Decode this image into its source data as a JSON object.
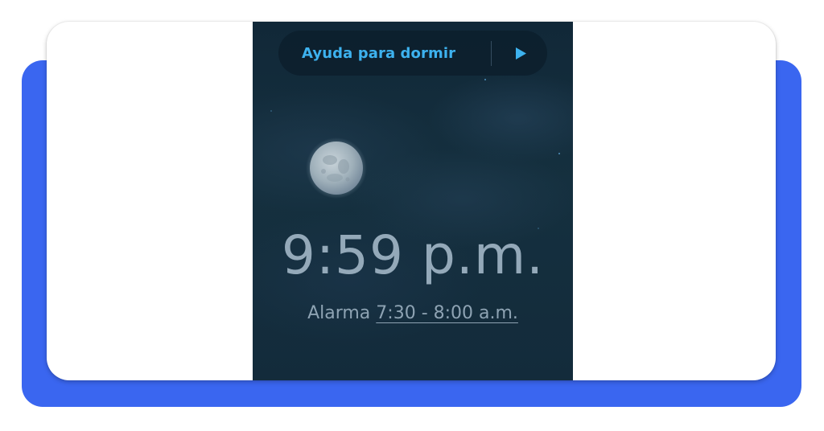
{
  "sleep_aid": {
    "label": "Ayuda para dormir",
    "play_icon": "play-icon"
  },
  "moon_icon": "moon-icon",
  "clock": {
    "time": "9:59 p.m."
  },
  "alarm": {
    "label": "Alarma",
    "range": "7:30 - 8:00 a.m."
  },
  "colors": {
    "accent": "#3db2ef",
    "background": "#132b3b",
    "text_muted": "#94a9b9",
    "frame_blue": "#3a66f0"
  }
}
